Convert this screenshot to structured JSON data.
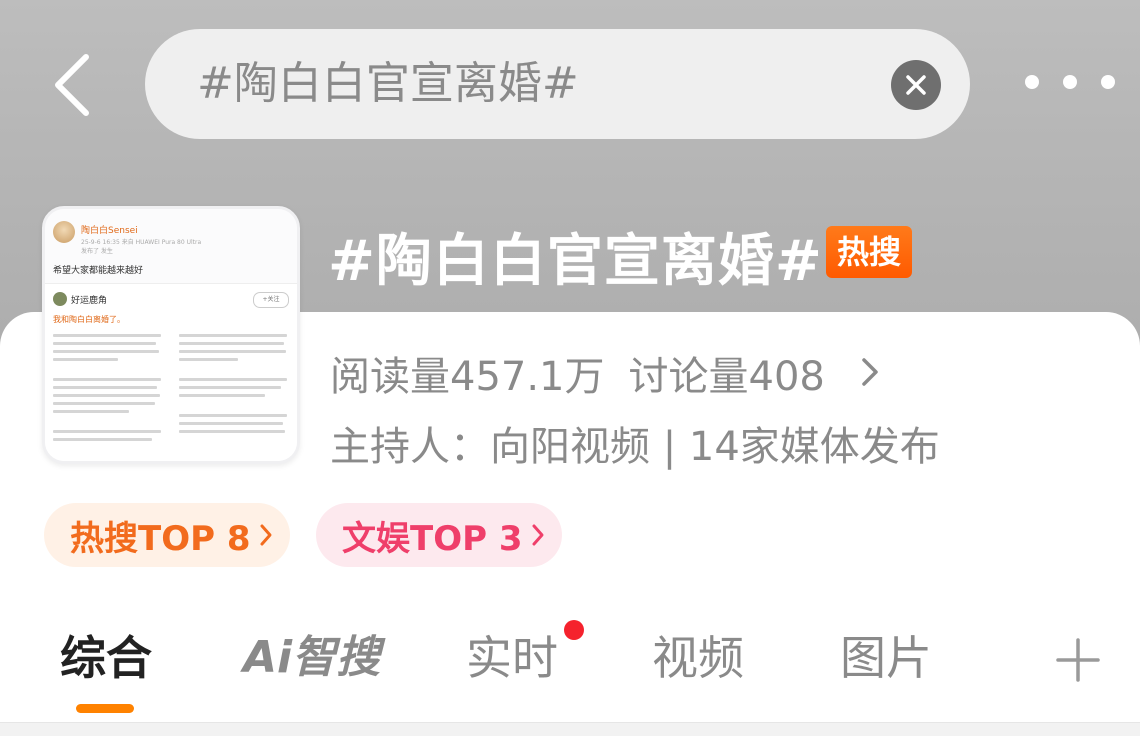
{
  "search": {
    "query": "#陶白白官宣离婚#"
  },
  "topic": {
    "title": "#陶白白官宣离婚#",
    "badge": "热搜",
    "reads": "阅读量457.1万",
    "discussions": "讨论量408",
    "host": "主持人：向阳视频 | 14家媒体发布"
  },
  "thumbnail": {
    "author": "陶白白Sensei",
    "meta": "25-9-6 16:35 来自 HUAWEI Pura 80 Ultra",
    "meta2": "发布了 发生",
    "post_text": "希望大家都能越来越好",
    "commenter": "好运鹿角",
    "follow": "+关注",
    "comment_text": "我和陶白白离婚了。"
  },
  "ranks": {
    "hot": "热搜TOP 8",
    "ent": "文娱TOP 3"
  },
  "tabs": {
    "items": [
      {
        "label": "综合"
      },
      {
        "label": "Ai智搜"
      },
      {
        "label": "实时"
      },
      {
        "label": "视频"
      },
      {
        "label": "图片"
      }
    ],
    "active": "综合"
  },
  "colors": {
    "accent_orange": "#ff8200",
    "hot_badge": "#ff6a0a",
    "ent_pink": "#ef3f6a",
    "red_dot": "#f5222d"
  },
  "icons": [
    "back-arrow-icon",
    "clear-icon",
    "more-icon",
    "chevron-right-icon",
    "plus-icon"
  ]
}
